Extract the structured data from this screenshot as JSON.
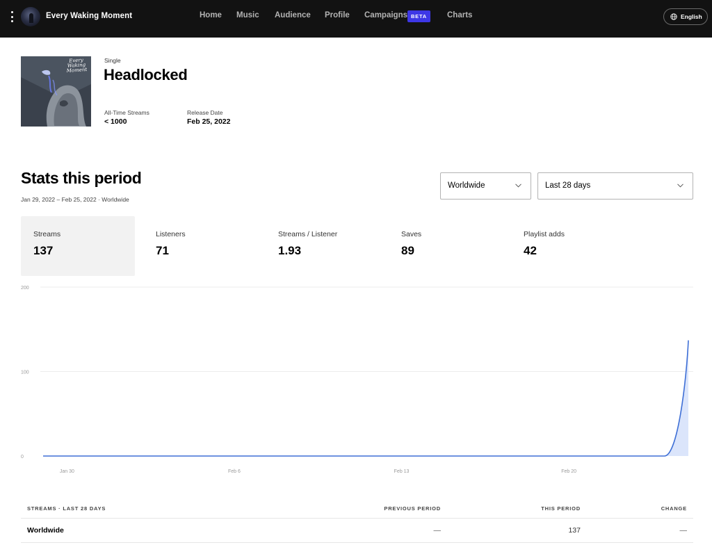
{
  "topbar": {
    "artist_name": "Every Waking Moment",
    "nav": [
      {
        "label": "Home"
      },
      {
        "label": "Music"
      },
      {
        "label": "Audience"
      },
      {
        "label": "Profile"
      },
      {
        "label": "Campaigns"
      },
      {
        "label": "Charts"
      }
    ],
    "beta_badge": "BETA",
    "language": "English",
    "icons": {
      "menu": "kebab-menu-icon",
      "language": "globe-icon"
    }
  },
  "release": {
    "cover_text": "Every Waking Moment",
    "type": "Single",
    "title": "Headlocked",
    "all_time_streams_label": "All-Time Streams",
    "all_time_streams_value": "< 1000",
    "release_date_label": "Release Date",
    "release_date_value": "Feb 25, 2022"
  },
  "stats": {
    "title": "Stats this period",
    "subtitle": "Jan 29, 2022 – Feb 25, 2022 · Worldwide",
    "location_select": "Worldwide",
    "period_select": "Last 28 days",
    "metrics": [
      {
        "label": "Streams",
        "value": "137",
        "active": true
      },
      {
        "label": "Listeners",
        "value": "71",
        "active": false
      },
      {
        "label": "Streams / Listener",
        "value": "1.93",
        "active": false
      },
      {
        "label": "Saves",
        "value": "89",
        "active": false
      },
      {
        "label": "Playlist adds",
        "value": "42",
        "active": false
      }
    ]
  },
  "chart_data": {
    "type": "area",
    "title": "",
    "xlabel": "",
    "ylabel": "",
    "ylim": [
      0,
      200
    ],
    "y_ticks": [
      "0",
      "100",
      "200"
    ],
    "x_ticks": [
      "Jan 30",
      "Feb 6",
      "Feb 13",
      "Feb 20"
    ],
    "x": [
      "Jan 29",
      "Jan 30",
      "Jan 31",
      "Feb 1",
      "Feb 2",
      "Feb 3",
      "Feb 4",
      "Feb 5",
      "Feb 6",
      "Feb 7",
      "Feb 8",
      "Feb 9",
      "Feb 10",
      "Feb 11",
      "Feb 12",
      "Feb 13",
      "Feb 14",
      "Feb 15",
      "Feb 16",
      "Feb 17",
      "Feb 18",
      "Feb 19",
      "Feb 20",
      "Feb 21",
      "Feb 22",
      "Feb 23",
      "Feb 24",
      "Feb 25"
    ],
    "series": [
      {
        "name": "Streams",
        "values": [
          0,
          0,
          0,
          0,
          0,
          0,
          0,
          0,
          0,
          0,
          0,
          0,
          0,
          0,
          0,
          0,
          0,
          0,
          0,
          0,
          0,
          0,
          0,
          0,
          0,
          0,
          0,
          137
        ]
      }
    ],
    "grid": true,
    "colors": {
      "line": "#3e6fd6",
      "fill": "#dbe5fb",
      "grid": "#ececec"
    }
  },
  "table": {
    "headers": [
      "STREAMS · LAST 28 DAYS",
      "PREVIOUS PERIOD",
      "THIS PERIOD",
      "CHANGE"
    ],
    "rows": [
      {
        "region": "Worldwide",
        "previous": "—",
        "current": "137",
        "change": "—"
      }
    ]
  }
}
